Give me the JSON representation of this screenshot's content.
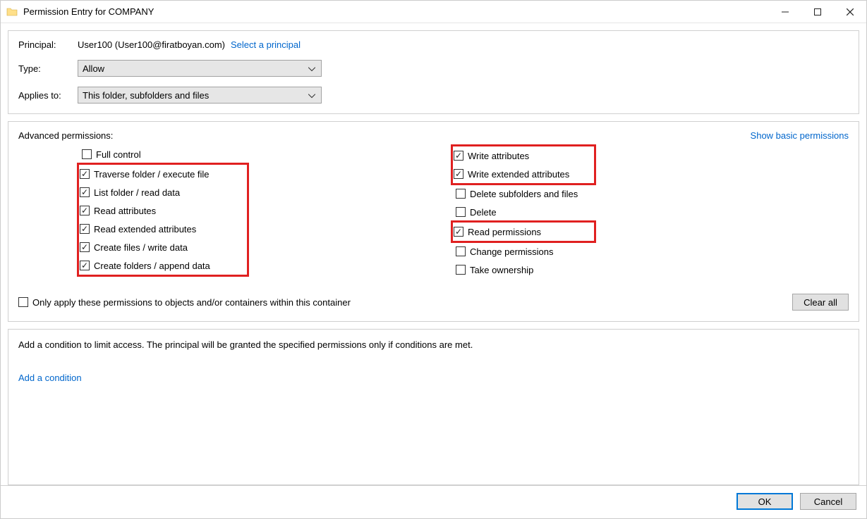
{
  "window": {
    "title": "Permission Entry for COMPANY"
  },
  "principal": {
    "label": "Principal:",
    "value": "User100 (User100@firatboyan.com)",
    "select_link": "Select a principal"
  },
  "type": {
    "label": "Type:",
    "value": "Allow"
  },
  "applies_to": {
    "label": "Applies to:",
    "value": "This folder, subfolders and files"
  },
  "permissions": {
    "heading": "Advanced permissions:",
    "basic_link": "Show basic permissions",
    "left": [
      {
        "label": "Full control",
        "checked": false,
        "highlight": false
      },
      {
        "label": "Traverse folder / execute file",
        "checked": true,
        "highlight": true
      },
      {
        "label": "List folder / read data",
        "checked": true,
        "highlight": true
      },
      {
        "label": "Read attributes",
        "checked": true,
        "highlight": true
      },
      {
        "label": "Read extended attributes",
        "checked": true,
        "highlight": true
      },
      {
        "label": "Create files / write data",
        "checked": true,
        "highlight": true
      },
      {
        "label": "Create folders / append data",
        "checked": true,
        "highlight": true
      }
    ],
    "right": [
      {
        "label": "Write attributes",
        "checked": true,
        "highlight": true
      },
      {
        "label": "Write extended attributes",
        "checked": true,
        "highlight": true
      },
      {
        "label": "Delete subfolders and files",
        "checked": false,
        "highlight": false
      },
      {
        "label": "Delete",
        "checked": false,
        "highlight": false
      },
      {
        "label": "Read permissions",
        "checked": true,
        "highlight_single": true
      },
      {
        "label": "Change permissions",
        "checked": false,
        "highlight": false
      },
      {
        "label": "Take ownership",
        "checked": false,
        "highlight": false
      }
    ],
    "only_apply": {
      "label": "Only apply these permissions to objects and/or containers within this container",
      "checked": false
    },
    "clear_all": "Clear all"
  },
  "condition": {
    "text": "Add a condition to limit access. The principal will be granted the specified permissions only if conditions are met.",
    "add_link": "Add a condition"
  },
  "buttons": {
    "ok": "OK",
    "cancel": "Cancel"
  }
}
